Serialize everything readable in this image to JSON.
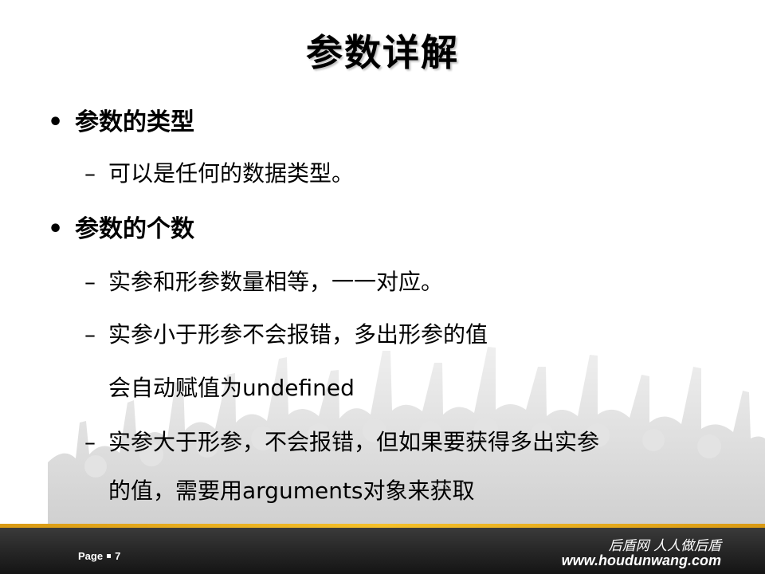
{
  "slide": {
    "title": "参数详解",
    "items": [
      {
        "bullet": "•",
        "text": "参数的类型"
      },
      {
        "dash": "–",
        "text": "可以是任何的数据类型。"
      },
      {
        "bullet": "•",
        "text": "参数的个数"
      },
      {
        "dash": "–",
        "text": "实参和形参数量相等，一一对应。"
      },
      {
        "dash": "–",
        "text": "实参小于形参不会报错，多出形参的值"
      },
      {
        "text": "会自动赋值为undefined"
      },
      {
        "dash": "–",
        "text": "实参大于形参，不会报错，但如果要获得多出实参"
      },
      {
        "text": "的值，需要用arguments对象来获取"
      }
    ]
  },
  "footer": {
    "page_label": "Page",
    "page_number": "7",
    "slogan": "后盾网 人人做后盾",
    "website": "www.houdunwang.com"
  },
  "colors": {
    "accent_stripe": "#f4c02a",
    "footer_bg": "#1e1e1e",
    "crowd": "#dcdcdc"
  }
}
